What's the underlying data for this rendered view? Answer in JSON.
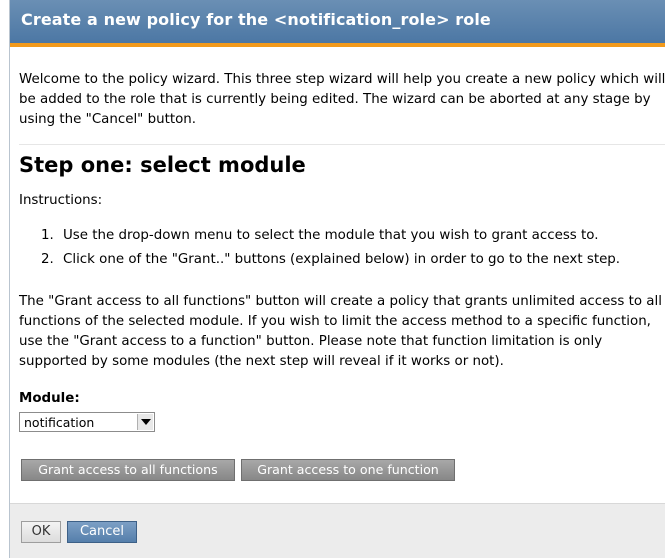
{
  "dialog": {
    "title": "Create a new policy for the <notification_role> role",
    "intro": "Welcome to the policy wizard. This three step wizard will help you create a new policy which will be added to the role that is currently being edited. The wizard can be aborted at any stage by using the \"Cancel\" button.",
    "step_heading": "Step one: select module",
    "instructions_label": "Instructions:",
    "steps": [
      {
        "num": "1.",
        "text": "Use the drop-down menu to select the module that you wish to grant access to."
      },
      {
        "num": "2.",
        "text": "Click one of the \"Grant..\" buttons (explained below) in order to go to the next step."
      }
    ],
    "explanation": "The \"Grant access to all functions\" button will create a policy that grants unlimited access to all functions of the selected module. If you wish to limit the access method to a specific function, use the \"Grant access to a function\" button. Please note that function limitation is only supported by some modules (the next step will reveal if it works or not).",
    "module_label": "Module:",
    "module_select": {
      "value": "notification"
    },
    "buttons": {
      "grant_all": "Grant access to all functions",
      "grant_one": "Grant access to one function",
      "ok": "OK",
      "cancel": "Cancel"
    }
  },
  "colors": {
    "title_bar": "#577fab",
    "title_accent": "#f29a1c",
    "footer": "#ececec",
    "grant_button": "#999999",
    "cancel_button": "#6a8fb8"
  },
  "icons": {
    "select_arrow": "chevron-down-icon"
  }
}
